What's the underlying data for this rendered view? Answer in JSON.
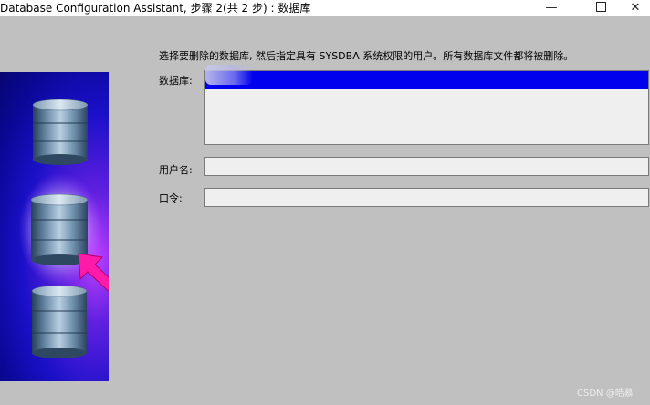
{
  "window": {
    "title": "Database Configuration Assistant, 步骤 2(共 2 步) : 数据库",
    "minimize_glyph": "—",
    "close_glyph": "✕"
  },
  "instruction": "选择要删除的数据库, 然后指定具有 SYSDBA 系统权限的用户。所有数据库文件都将被删除。",
  "form": {
    "database_label": "数据库:",
    "username_label": "用户名:",
    "username_value": "",
    "password_label": "口令:",
    "password_value": ""
  },
  "watermark": "CSDN @皓慕",
  "colors": {
    "background": "#c0c0c0",
    "selection": "#0000ee",
    "arrow": "#ff1aaa"
  },
  "icons": [
    "database-cylinder-icon",
    "pointer-arrow-icon"
  ]
}
